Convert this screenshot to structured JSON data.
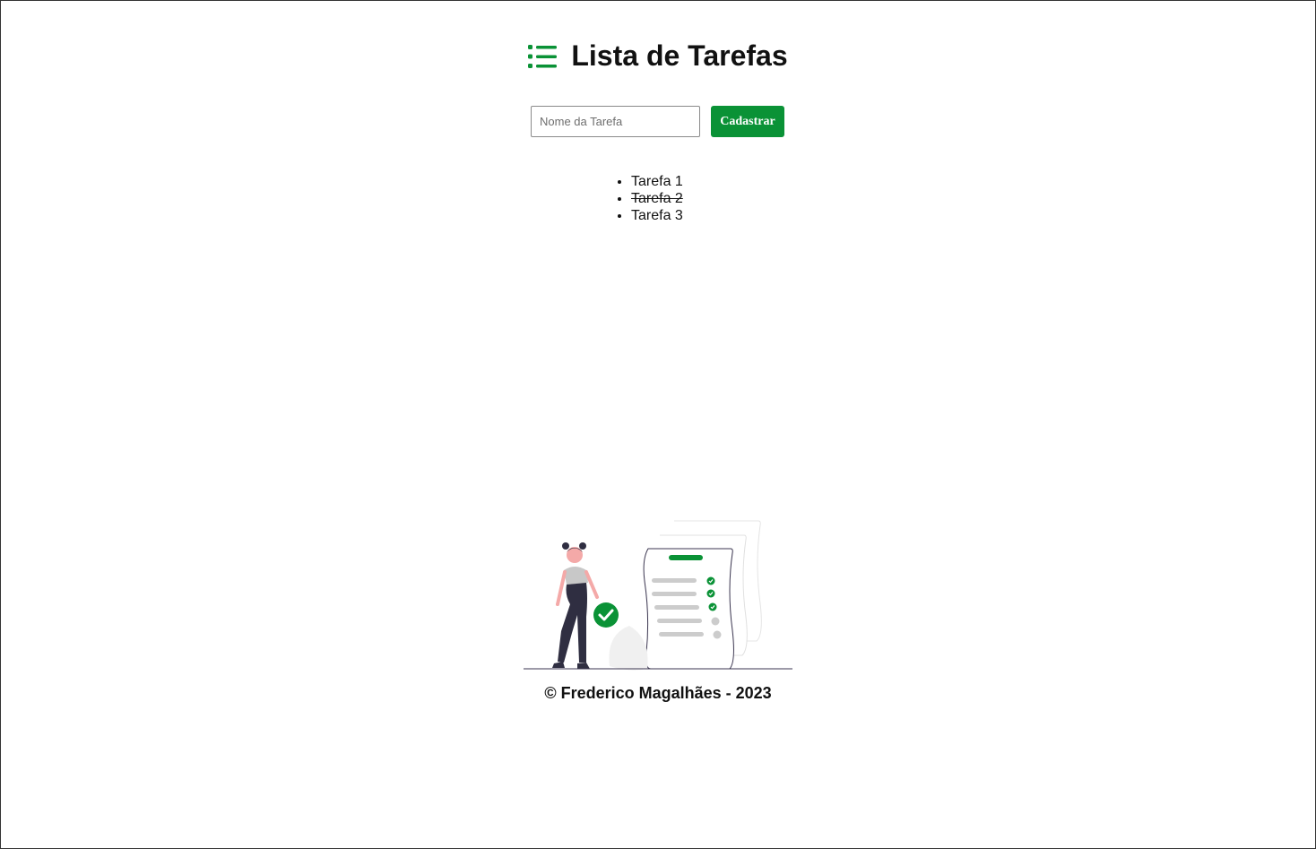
{
  "header": {
    "title": "Lista de Tarefas",
    "icon": "list-icon"
  },
  "form": {
    "input_placeholder": "Nome da Tarefa",
    "input_value": "",
    "submit_label": "Cadastrar"
  },
  "tasks": [
    {
      "label": "Tarefa 1",
      "done": false
    },
    {
      "label": "Tarefa 2",
      "done": true
    },
    {
      "label": "Tarefa 3",
      "done": false
    }
  ],
  "illustration": {
    "icon": "person-with-checklist-illustration"
  },
  "footer": {
    "text": "© Frederico Magalhães - 2023"
  },
  "colors": {
    "accent": "#0a9236",
    "text": "#111111",
    "background": "#ffffff"
  }
}
